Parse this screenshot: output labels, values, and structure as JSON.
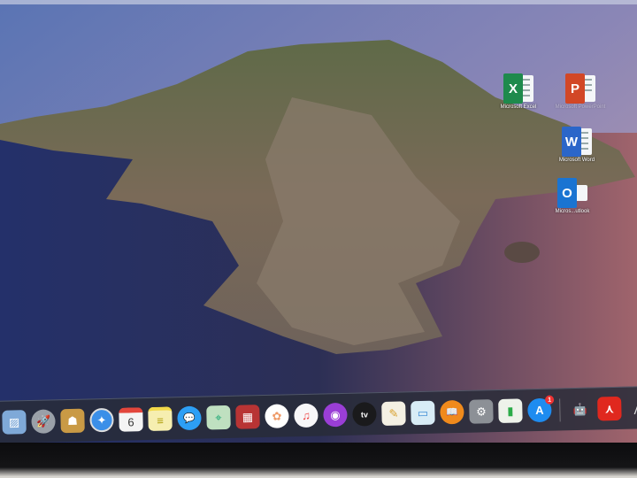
{
  "desktop": {
    "icons": [
      {
        "name": "Microsoft Excel",
        "label": "Microsoft Excel",
        "letter": "X",
        "color": "#1e8a4c"
      },
      {
        "name": "Microsoft PowerPoint",
        "label": "Microsoft PowerPoint",
        "letter": "P",
        "color": "#d24726"
      },
      {
        "name": "Microsoft Word",
        "label": "Microsoft Word",
        "letter": "W",
        "color": "#2b66c9"
      },
      {
        "name": "Microsoft Outlook",
        "label": "Micros...utlook",
        "letter": "O",
        "color": "#1a74d2"
      }
    ]
  },
  "dock": {
    "apps": [
      {
        "name": "Preview",
        "glyph": "▨"
      },
      {
        "name": "Launchpad",
        "glyph": "🚀"
      },
      {
        "name": "Contacts",
        "glyph": "☗"
      },
      {
        "name": "Safari",
        "glyph": "✦"
      },
      {
        "name": "Calendar",
        "glyph": "6"
      },
      {
        "name": "Notes",
        "glyph": "≡"
      },
      {
        "name": "Messages",
        "glyph": "💬"
      },
      {
        "name": "Maps",
        "glyph": "⌖"
      },
      {
        "name": "Photo Booth",
        "glyph": "▦"
      },
      {
        "name": "Photos",
        "glyph": "✿"
      },
      {
        "name": "Music",
        "glyph": "♫"
      },
      {
        "name": "Podcasts",
        "glyph": "◉"
      },
      {
        "name": "TV",
        "glyph": "tv"
      },
      {
        "name": "Pages",
        "glyph": "✎"
      },
      {
        "name": "Keynote",
        "glyph": "▭"
      },
      {
        "name": "Books",
        "glyph": "📖"
      },
      {
        "name": "System Preferences",
        "glyph": "⚙"
      },
      {
        "name": "Numbers",
        "glyph": "▮"
      },
      {
        "name": "App Store",
        "glyph": "A",
        "badge": "1"
      },
      {
        "name": "Automator",
        "glyph": "🤖"
      },
      {
        "name": "Adobe Acrobat Reader",
        "glyph": "⋏"
      },
      {
        "name": "Instruments",
        "glyph": "⋀"
      }
    ]
  }
}
